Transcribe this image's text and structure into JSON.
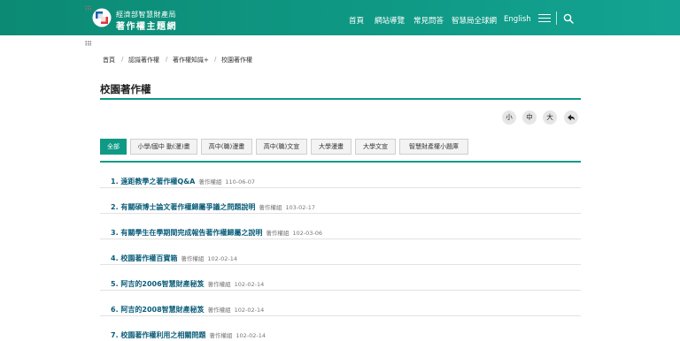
{
  "header": {
    "logo_line1": "經濟部智慧財產局",
    "logo_line2": "著作權主題網",
    "nav": [
      "首頁",
      "網站導覽",
      "常見問答",
      "智慧局全球網",
      "English"
    ]
  },
  "breadcrumb": [
    "首頁",
    "認識著作權",
    "著作權知識+",
    "校園著作權"
  ],
  "page_title": "校園著作權",
  "font_controls": [
    "小",
    "中",
    "大"
  ],
  "tabs": [
    "全部",
    "小學/國中 動(漫)畫",
    "高中(職)漫畫",
    "高中(職)文宣",
    "大學漫畫",
    "大學文宣",
    "智慧財產權小題庫"
  ],
  "active_tab": "全部",
  "articles": [
    {
      "title": "1. 遠距教學之著作權Q&A",
      "unit": "著作權組",
      "date": "110-06-07"
    },
    {
      "title": "2. 有關碩博士論文著作權歸屬爭議之問題說明",
      "unit": "著作權組",
      "date": "103-02-17"
    },
    {
      "title": "3. 有關學生在學期間完成報告著作權歸屬之說明",
      "unit": "著作權組",
      "date": "102-03-06"
    },
    {
      "title": "4. 校園著作權百寶箱",
      "unit": "著作權組",
      "date": "102-02-14"
    },
    {
      "title": "5. 阿吉的2006智慧財產秘笈",
      "unit": "著作權組",
      "date": "102-02-14"
    },
    {
      "title": "6. 阿吉的2008智慧財產秘笈",
      "unit": "著作權組",
      "date": "102-02-14"
    },
    {
      "title": "7. 校園著作權利用之相關問題",
      "unit": "著作權組",
      "date": "102-02-14"
    }
  ],
  "colors": {
    "header": "#0f9a86",
    "accent": "#0f9a86",
    "link": "#0b5d7a"
  },
  "icons": {
    "logo": "tipo-logo-icon",
    "menu": "hamburger-icon",
    "search": "search-icon",
    "back": "back-arrow-icon"
  }
}
